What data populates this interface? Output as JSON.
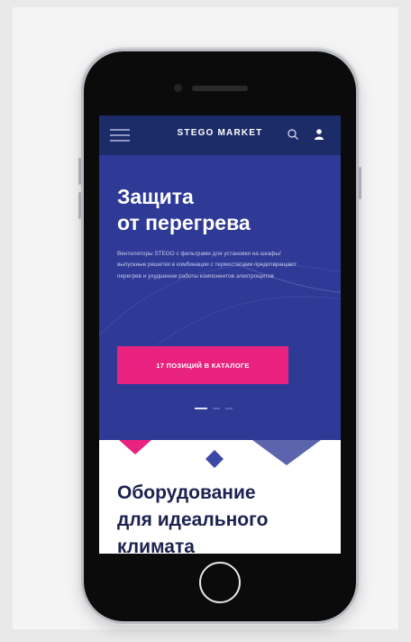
{
  "header": {
    "brand": "STEGO MARKET",
    "menu_icon": "menu-icon",
    "search_icon": "search-icon",
    "user_icon": "user-icon"
  },
  "hero": {
    "title_line1": "Защита",
    "title_line2": "от перегрева",
    "description": "Вентиляторы STEGO с фильтрами для установки на шкафы/выпускные решетки в комбинации с термостатами предотвращают перегрев и ухудшение работы компонентов электрощитов",
    "cta_label": "17 ПОЗИЦИЙ В КАТАЛОГЕ",
    "slides_total": 3,
    "slide_active": 1
  },
  "section": {
    "title_line1": "Оборудование",
    "title_line2": "для идеального",
    "title_line3": "климата"
  },
  "colors": {
    "nav_bg": "#1c2c69",
    "hero_bg": "#2e3a96",
    "accent_pink": "#e8227e",
    "shape_blue": "#3d47a8",
    "shape_slate": "#5b64ad",
    "title_dark": "#1b2150"
  }
}
